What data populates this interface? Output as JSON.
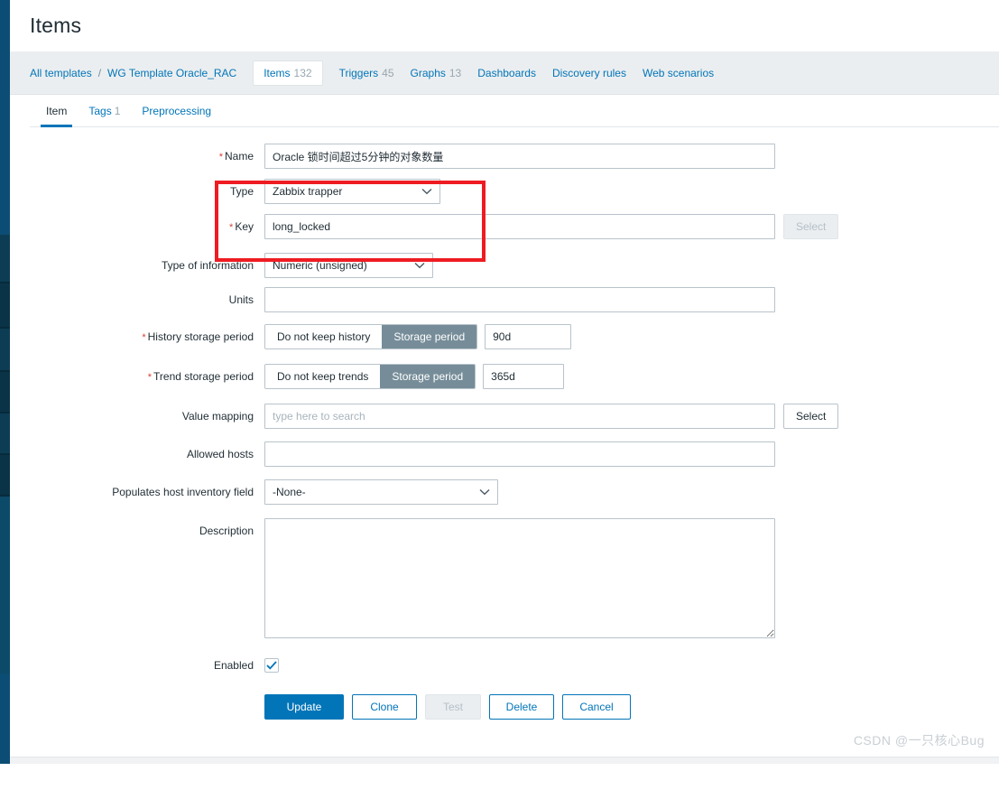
{
  "page": {
    "title": "Items"
  },
  "breadcrumb": {
    "all_templates": "All templates",
    "separator": "/",
    "template_name": "WG Template Oracle_RAC",
    "object_tabs": [
      {
        "label": "Items",
        "count": "132",
        "active": true
      },
      {
        "label": "Triggers",
        "count": "45",
        "active": false
      },
      {
        "label": "Graphs",
        "count": "13",
        "active": false
      },
      {
        "label": "Dashboards",
        "count": "",
        "active": false
      },
      {
        "label": "Discovery rules",
        "count": "",
        "active": false
      },
      {
        "label": "Web scenarios",
        "count": "",
        "active": false
      }
    ]
  },
  "form_tabs": [
    {
      "label": "Item",
      "count": "",
      "active": true
    },
    {
      "label": "Tags",
      "count": "1",
      "active": false
    },
    {
      "label": "Preprocessing",
      "count": "",
      "active": false
    }
  ],
  "form": {
    "name": {
      "label": "Name",
      "required": true,
      "value": "Oracle 锁时间超过5分钟的对象数量",
      "placeholder": ""
    },
    "type": {
      "label": "Type",
      "required": false,
      "value": "Zabbix trapper",
      "options": [
        "Zabbix trapper"
      ]
    },
    "key": {
      "label": "Key",
      "required": true,
      "value": "long_locked",
      "placeholder": "",
      "select_button": "Select",
      "select_disabled": true
    },
    "type_of_information": {
      "label": "Type of information",
      "required": false,
      "value": "Numeric (unsigned)",
      "options": [
        "Numeric (unsigned)"
      ]
    },
    "units": {
      "label": "Units",
      "required": false,
      "value": "",
      "placeholder": ""
    },
    "history_storage_period": {
      "label": "History storage period",
      "required": true,
      "options": [
        "Do not keep history",
        "Storage period"
      ],
      "selected": "Storage period",
      "value": "90d"
    },
    "trend_storage_period": {
      "label": "Trend storage period",
      "required": true,
      "options": [
        "Do not keep trends",
        "Storage period"
      ],
      "selected": "Storage period",
      "value": "365d"
    },
    "value_mapping": {
      "label": "Value mapping",
      "required": false,
      "value": "",
      "placeholder": "type here to search",
      "select_button": "Select",
      "select_disabled": false
    },
    "allowed_hosts": {
      "label": "Allowed hosts",
      "required": false,
      "value": "",
      "placeholder": ""
    },
    "populates_host_inventory_field": {
      "label": "Populates host inventory field",
      "required": false,
      "value": "-None-",
      "options": [
        "-None-"
      ]
    },
    "description": {
      "label": "Description",
      "required": false,
      "value": "",
      "placeholder": ""
    },
    "enabled": {
      "label": "Enabled",
      "checked": true
    }
  },
  "footer_buttons": [
    {
      "label": "Update",
      "style": "primary",
      "disabled": false
    },
    {
      "label": "Clone",
      "style": "outline",
      "disabled": false
    },
    {
      "label": "Test",
      "style": "disabled",
      "disabled": true
    },
    {
      "label": "Delete",
      "style": "outline",
      "disabled": false
    },
    {
      "label": "Cancel",
      "style": "outline",
      "disabled": false
    }
  ],
  "annotation": {
    "color": "#ee1c22",
    "label": "type-and-key-highlight"
  },
  "watermark": {
    "text": "CSDN @一只核心Bug"
  },
  "colors": {
    "accent": "#0275b8",
    "sidebar": "#0b4d74",
    "required_marker": "#d44136",
    "segment_selected": "#768d99",
    "breadcrumb_bg": "#ebeef0"
  }
}
